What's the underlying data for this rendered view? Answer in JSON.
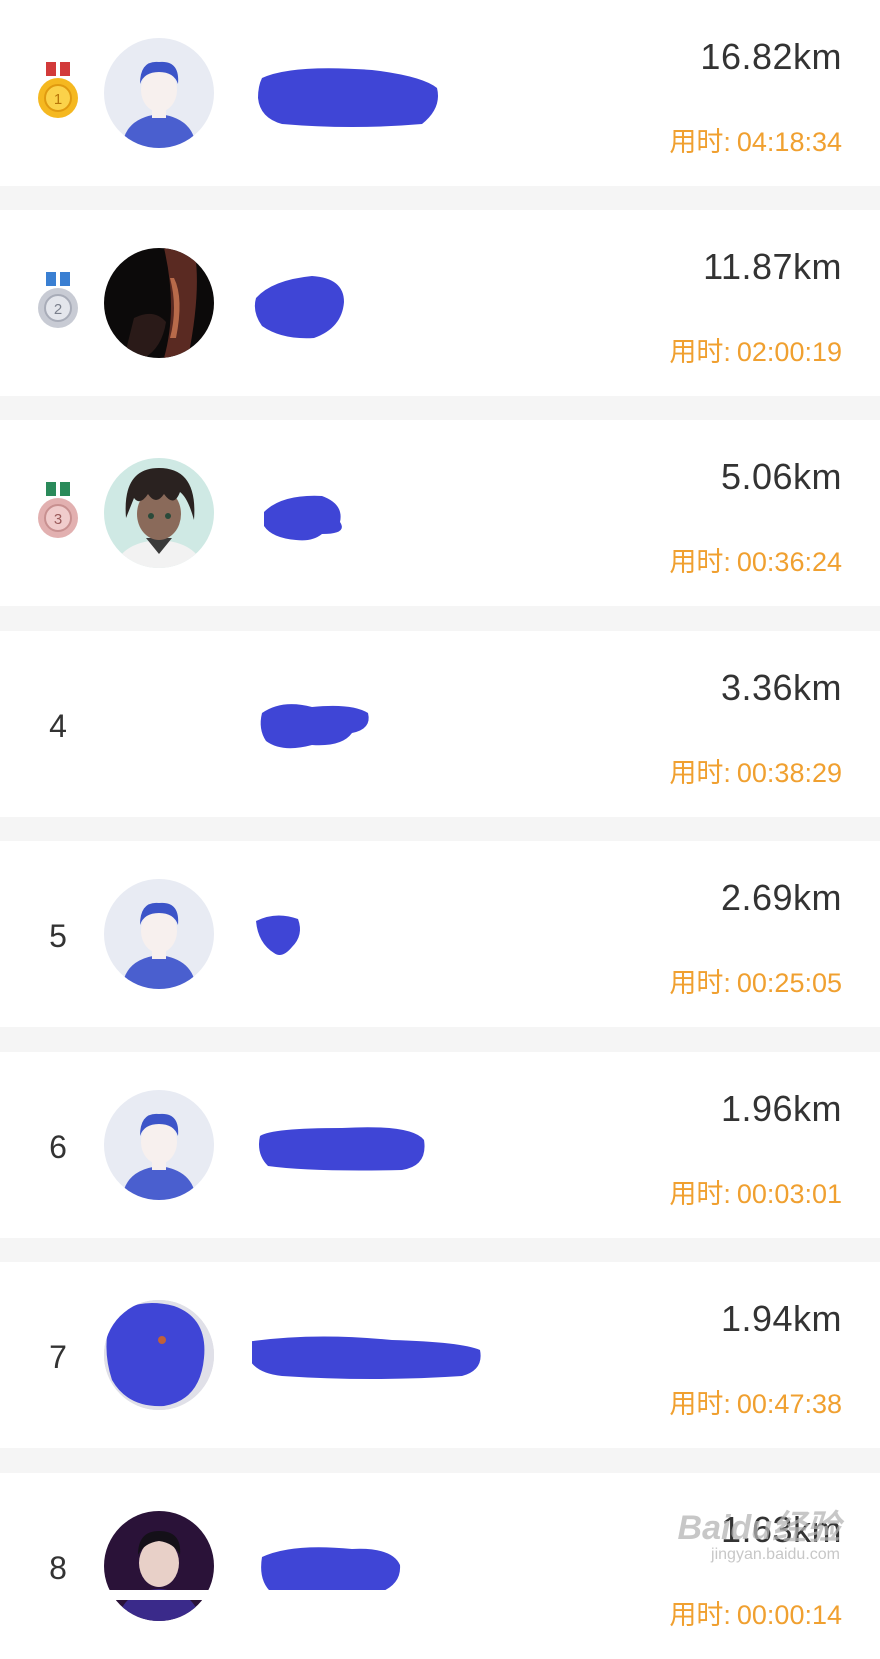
{
  "leaderboard": {
    "entries": [
      {
        "rank": "1",
        "medal": "gold",
        "distance": "16.82km",
        "duration_label": "用时:",
        "duration": "04:18:34",
        "avatar": "default-male"
      },
      {
        "rank": "2",
        "medal": "silver",
        "distance": "11.87km",
        "duration_label": "用时:",
        "duration": "02:00:19",
        "avatar": "dark-photo"
      },
      {
        "rank": "3",
        "medal": "bronze",
        "distance": "5.06km",
        "duration_label": "用时:",
        "duration": "00:36:24",
        "avatar": "anime-character"
      },
      {
        "rank": "4",
        "medal": "",
        "distance": "3.36km",
        "duration_label": "用时:",
        "duration": "00:38:29",
        "avatar": "none"
      },
      {
        "rank": "5",
        "medal": "",
        "distance": "2.69km",
        "duration_label": "用时:",
        "duration": "00:25:05",
        "avatar": "default-male"
      },
      {
        "rank": "6",
        "medal": "",
        "distance": "1.96km",
        "duration_label": "用时:",
        "duration": "00:03:01",
        "avatar": "default-male"
      },
      {
        "rank": "7",
        "medal": "",
        "distance": "1.94km",
        "duration_label": "用时:",
        "duration": "00:47:38",
        "avatar": "redacted-photo"
      },
      {
        "rank": "8",
        "medal": "",
        "distance": "1.63km",
        "duration_label": "用时:",
        "duration": "00:00:14",
        "avatar": "portrait-photo"
      }
    ]
  },
  "watermark": {
    "brand": "Baidu经验",
    "site": "jingyan.baidu.com"
  },
  "colors": {
    "background": "#f5f5f5",
    "card": "#ffffff",
    "distance_text": "#333333",
    "duration_text": "#f0a030",
    "redaction": "#3f45d6",
    "gold": "#f5b820",
    "silver": "#c8cbd4",
    "bronze": "#e2b0b0"
  }
}
